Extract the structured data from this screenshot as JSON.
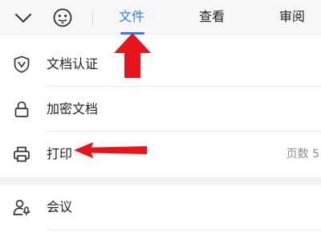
{
  "header": {
    "tabs": [
      {
        "label": "文件",
        "active": true
      },
      {
        "label": "查看",
        "active": false
      },
      {
        "label": "审阅",
        "active": false
      }
    ],
    "accent_color": "#2f7cf6",
    "icons": {
      "collapse": "chevron-down-icon",
      "emoji": "emoji-face-icon"
    }
  },
  "menu": {
    "items": [
      {
        "label": "文档认证",
        "icon": "shield-check-icon"
      },
      {
        "label": "加密文档",
        "icon": "lock-icon"
      },
      {
        "label": "打印",
        "icon": "printer-icon",
        "value": "页数 5"
      },
      {
        "label": "会议",
        "icon": "meeting-user-icon"
      }
    ]
  },
  "annotations": {
    "color": "#e8141c",
    "arrows": [
      "arrow-up-to-file-tab",
      "arrow-left-to-print"
    ]
  }
}
